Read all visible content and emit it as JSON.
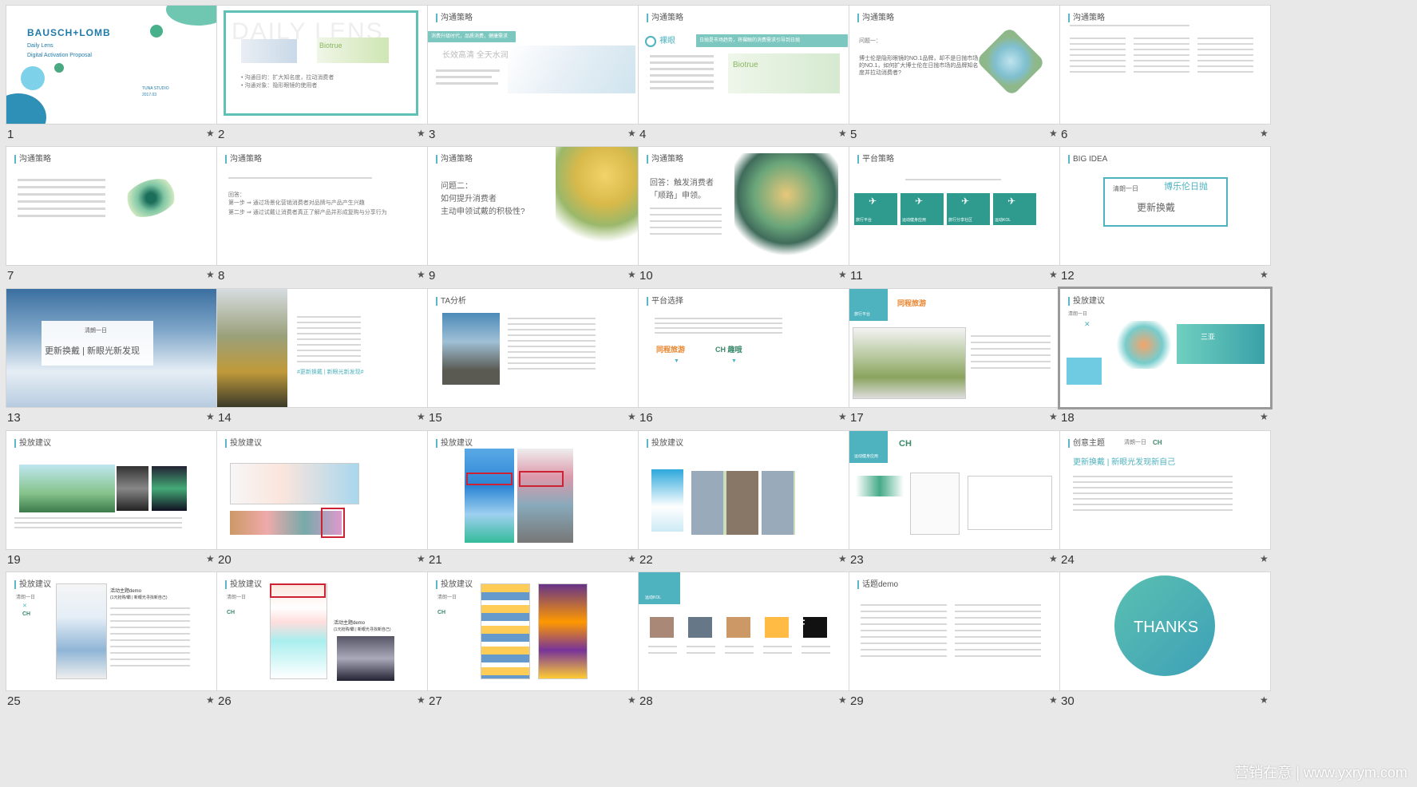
{
  "slides": [
    {
      "num": "1",
      "lines": [
        "BAUSCH+LOMB",
        "Daily Lens",
        "Digital Activation Proposal",
        "TUNA STUDIO",
        "2017.03"
      ]
    },
    {
      "num": "2",
      "lines": [
        "DAILY LENS",
        "Biotrue",
        "• 沟通目的：扩大知名度，拉动消费者",
        "• 沟通对象：隐形眼镜的使用者"
      ]
    },
    {
      "num": "3",
      "heading": "沟通策略",
      "lines": [
        "消费升级时代，品质消费，健康需求",
        "长效高清 全天水润"
      ]
    },
    {
      "num": "4",
      "heading": "沟通策略",
      "lines": [
        "裸眼",
        "日抛是市场趋势，将裸眼的消费需求引导到日抛",
        "Biotrue"
      ]
    },
    {
      "num": "5",
      "heading": "沟通策略",
      "lines": [
        "问题一：",
        "博士伦是隐形眼镜的NO.1品牌，却不是日抛市场的NO.1，如何扩大博士伦在日抛市场的品牌知名度并拉动消费者?"
      ]
    },
    {
      "num": "6",
      "heading": "沟通策略",
      "lines": []
    },
    {
      "num": "7",
      "heading": "沟通策略",
      "lines": []
    },
    {
      "num": "8",
      "heading": "沟通策略",
      "lines": [
        "回答：",
        "第一步 ⇒ 通过场景化营销消费者对品牌与产品产生兴趣",
        "第二步 ⇒ 通过试戴让消费者真正了解产品并形成复购与分享行为"
      ]
    },
    {
      "num": "9",
      "heading": "沟通策略",
      "lines": [
        "问题二：",
        "如何提升消费者",
        "主动申领试戴的积极性?"
      ]
    },
    {
      "num": "10",
      "heading": "沟通策略",
      "lines": [
        "回答：触发消费者",
        "「顺路」申领。"
      ]
    },
    {
      "num": "11",
      "heading": "平台策略",
      "lines": [
        "旅行平台",
        "运动健身应用",
        "旅行分享社区",
        "运动KOL"
      ]
    },
    {
      "num": "12",
      "heading": "BIG IDEA",
      "lines": [
        "清朗一日",
        "博乐伦日抛",
        "更新换戴"
      ]
    },
    {
      "num": "13",
      "lines": [
        "清朗一日",
        "更新换戴 | 新眼光新发现"
      ]
    },
    {
      "num": "14",
      "lines": [
        "#更新换戴 | 新眼光新发现#"
      ]
    },
    {
      "num": "15",
      "heading": "TA分析",
      "lines": []
    },
    {
      "num": "16",
      "heading": "平台选择",
      "lines": [
        "同程旅游",
        "CH 趣哦"
      ]
    },
    {
      "num": "17",
      "lines": [
        "旅行平台",
        "同程旅游"
      ]
    },
    {
      "num": "18",
      "heading": "投放建议",
      "lines": [
        "清朗一日",
        "三亚"
      ]
    },
    {
      "num": "19",
      "heading": "投放建议",
      "lines": []
    },
    {
      "num": "20",
      "heading": "投放建议",
      "lines": []
    },
    {
      "num": "21",
      "heading": "投放建议",
      "lines": []
    },
    {
      "num": "22",
      "heading": "投放建议",
      "lines": []
    },
    {
      "num": "23",
      "lines": [
        "运动健身应用",
        "CH"
      ]
    },
    {
      "num": "24",
      "heading": "创意主题",
      "lines": [
        "清朗一日",
        "CH",
        "更新换戴 | 新眼光发现新自己"
      ]
    },
    {
      "num": "25",
      "heading": "投放建议",
      "lines": [
        "清朗一日",
        "CH",
        "活动主题demo",
        "(1元抢购/霸 | 新眼光寻找新自己)"
      ]
    },
    {
      "num": "26",
      "heading": "投放建议",
      "lines": [
        "清朗一日",
        "CH",
        "活动主题demo",
        "(1元抢购/霸 | 新眼光寻找新自己)"
      ]
    },
    {
      "num": "27",
      "heading": "投放建议",
      "lines": [
        "清朗一日",
        "CH"
      ]
    },
    {
      "num": "28",
      "lines": [
        "运动KOL",
        "F"
      ]
    },
    {
      "num": "29",
      "heading": "话题demo",
      "lines": []
    },
    {
      "num": "30",
      "lines": [
        "THANKS"
      ]
    }
  ],
  "selected": "18",
  "star_glyph": "★",
  "watermark": "营销在意 | www.yxrym.com",
  "colors": {
    "accent": "#4fb3bf",
    "brand_blue": "#1f7aa8",
    "background": "#e8e8e8"
  }
}
